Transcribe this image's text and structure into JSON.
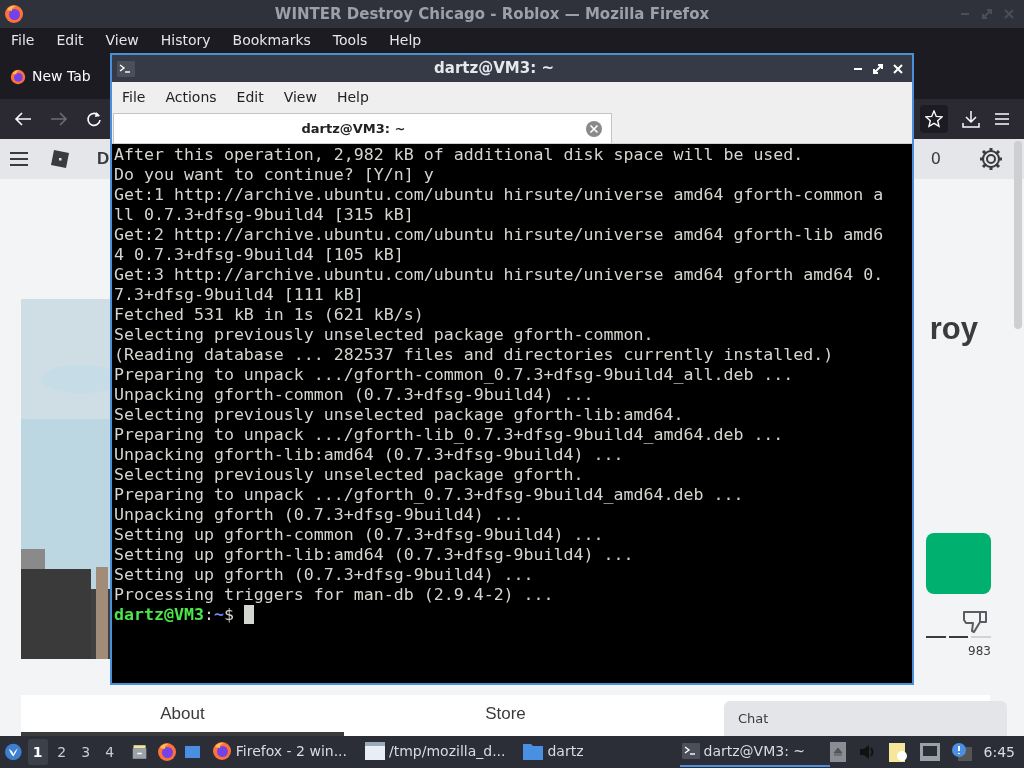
{
  "firefox": {
    "title": "WINTER Destroy Chicago - Roblox — Mozilla Firefox",
    "menu": [
      "File",
      "Edit",
      "View",
      "History",
      "Bookmarks",
      "Tools",
      "Help"
    ],
    "tabs": [
      {
        "label": "New Tab",
        "selected": true
      }
    ],
    "forward": {
      "disabled": true
    },
    "page": {
      "header_letter": "D",
      "robux": "0",
      "title": "roy",
      "dislikes": "983",
      "tabs": [
        {
          "label": "About",
          "selected": true
        },
        {
          "label": "Store",
          "selected": false
        }
      ],
      "chat": "Chat"
    }
  },
  "terminal": {
    "title": "dartz@VM3: ~",
    "menu": [
      "File",
      "Actions",
      "Edit",
      "View",
      "Help"
    ],
    "tabs": [
      {
        "label": "dartz@VM3: ~",
        "selected": true
      }
    ],
    "lines": [
      "After this operation, 2,982 kB of additional disk space will be used.",
      "Do you want to continue? [Y/n] y",
      "Get:1 http://archive.ubuntu.com/ubuntu hirsute/universe amd64 gforth-common a",
      "ll 0.7.3+dfsg-9build4 [315 kB]",
      "Get:2 http://archive.ubuntu.com/ubuntu hirsute/universe amd64 gforth-lib amd6",
      "4 0.7.3+dfsg-9build4 [105 kB]",
      "Get:3 http://archive.ubuntu.com/ubuntu hirsute/universe amd64 gforth amd64 0.",
      "7.3+dfsg-9build4 [111 kB]",
      "Fetched 531 kB in 1s (621 kB/s)",
      "Selecting previously unselected package gforth-common.",
      "(Reading database ... 282537 files and directories currently installed.)",
      "Preparing to unpack .../gforth-common_0.7.3+dfsg-9build4_all.deb ...",
      "Unpacking gforth-common (0.7.3+dfsg-9build4) ...",
      "Selecting previously unselected package gforth-lib:amd64.",
      "Preparing to unpack .../gforth-lib_0.7.3+dfsg-9build4_amd64.deb ...",
      "Unpacking gforth-lib:amd64 (0.7.3+dfsg-9build4) ...",
      "Selecting previously unselected package gforth.",
      "Preparing to unpack .../gforth_0.7.3+dfsg-9build4_amd64.deb ...",
      "Unpacking gforth (0.7.3+dfsg-9build4) ...",
      "Setting up gforth-common (0.7.3+dfsg-9build4) ...",
      "Setting up gforth-lib:amd64 (0.7.3+dfsg-9build4) ...",
      "Setting up gforth (0.7.3+dfsg-9build4) ...",
      "Processing triggers for man-db (2.9.4-2) ..."
    ],
    "prompt": {
      "user_host": "dartz@VM3",
      "sep": ":",
      "path": "~",
      "symbol": "$"
    }
  },
  "taskbar": {
    "workspaces": [
      {
        "label": "1",
        "selected": true
      },
      {
        "label": "2",
        "selected": false
      },
      {
        "label": "3",
        "selected": false
      },
      {
        "label": "4",
        "selected": false
      }
    ],
    "tasks": [
      {
        "kind": "firefox",
        "label": "Firefox - 2 win...",
        "selected": false
      },
      {
        "kind": "window",
        "label": "/tmp/mozilla_d...",
        "selected": false
      },
      {
        "kind": "folder",
        "label": "dartz",
        "selected": false
      },
      {
        "kind": "terminal",
        "label": "dartz@VM3: ~",
        "selected": true
      }
    ],
    "clock": "6:45"
  }
}
